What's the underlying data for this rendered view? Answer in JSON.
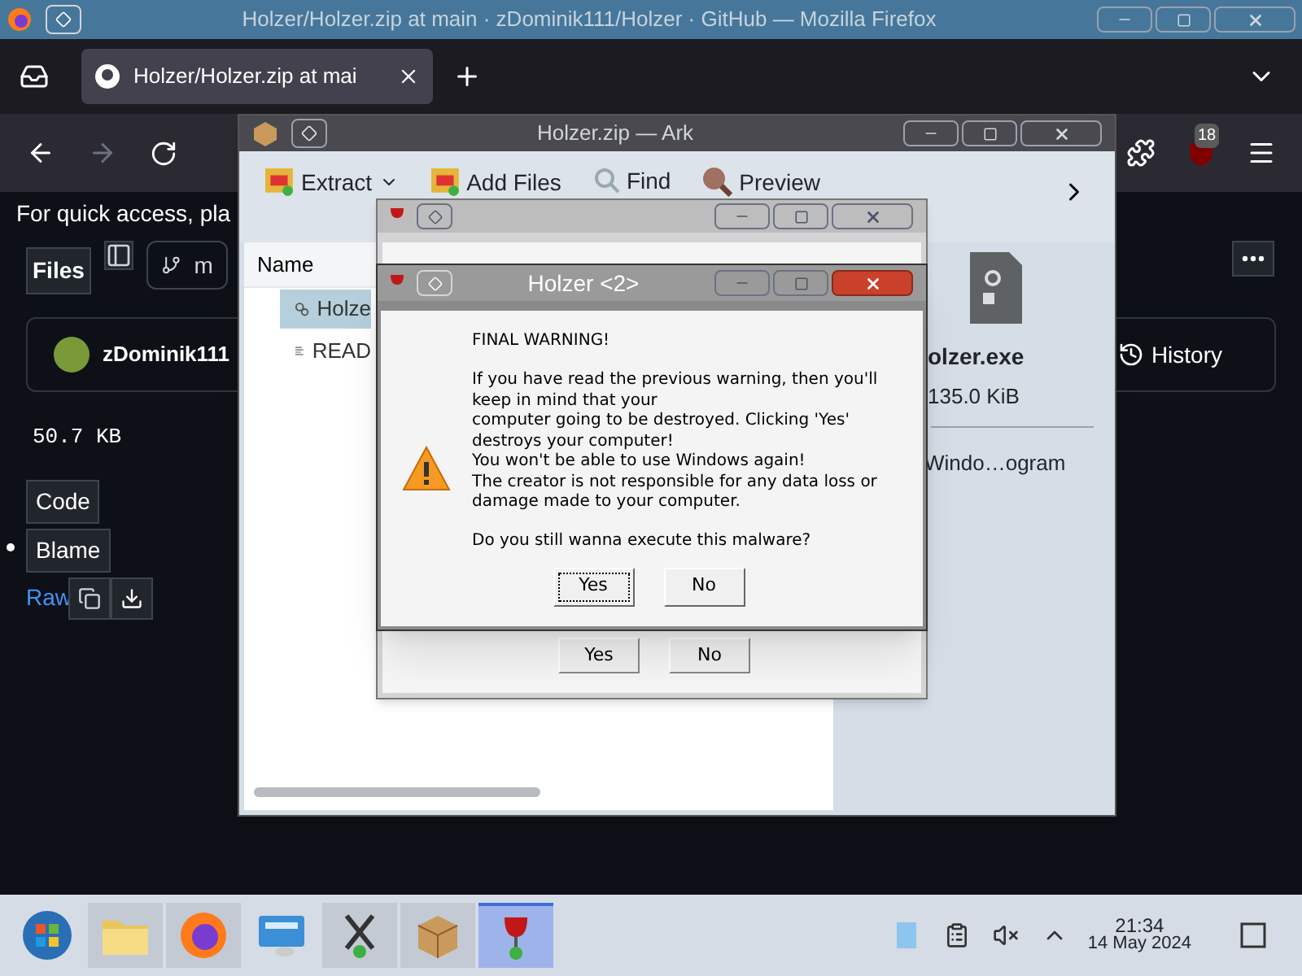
{
  "firefox": {
    "title": "Holzer/Holzer.zip at main · zDominik111/Holzer · GitHub — Mozilla Firefox",
    "tab": {
      "title": "Holzer/Holzer.zip at mai",
      "selected": true
    },
    "extension_badge": "18",
    "notice": "For quick access, pla",
    "github": {
      "files_button": "Files",
      "branch": "m",
      "author": "zDominik111",
      "history_button": "History",
      "size": "50.7 KB",
      "view_buttons": [
        "Code",
        "Blame"
      ],
      "raw_link": "Raw"
    }
  },
  "ark": {
    "title": "Holzer.zip — Ark",
    "toolbar": [
      {
        "label": "Extract",
        "kind": "extract",
        "dropdown": true
      },
      {
        "label": "Add Files",
        "kind": "add",
        "dropdown": false
      },
      {
        "label": "Find",
        "kind": "find",
        "dropdown": false
      },
      {
        "label": "Preview",
        "kind": "preview",
        "dropdown": false
      }
    ],
    "columns": [
      "Name"
    ],
    "rows": [
      {
        "name": "Holze",
        "kind": "program",
        "selected": true
      },
      {
        "name": "READ",
        "kind": "text",
        "selected": false
      }
    ],
    "details": {
      "name": "olzer.exe",
      "size": "135.0 KiB",
      "type": "Windo…ogram"
    }
  },
  "dialogs": [
    {
      "title": "Holzer <2>",
      "heading": "FINAL WARNING!",
      "message": "If you have read the previous warning, then you'll\nkeep in mind that your\ncomputer going to be destroyed. Clicking 'Yes'\ndestroys your computer!\nYou won't be able to use Windows again!\nThe creator is not responsible for any data loss or\ndamage made to your computer.",
      "question": "Do you still wanna execute this malware?",
      "buttons": [
        {
          "label": "Yes",
          "focused": true
        },
        {
          "label": "No",
          "focused": false
        }
      ]
    },
    {
      "buttons": [
        {
          "label": "Yes",
          "focused": false
        },
        {
          "label": "No",
          "focused": false
        }
      ]
    }
  ],
  "taskbar": {
    "apps": [
      {
        "kind": "start",
        "open": false,
        "selected": false
      },
      {
        "kind": "folder",
        "open": true,
        "selected": false
      },
      {
        "kind": "firefox",
        "open": true,
        "selected": false
      },
      {
        "kind": "remote",
        "open": false,
        "selected": false
      },
      {
        "kind": "tool",
        "open": true,
        "selected": false
      },
      {
        "kind": "archive",
        "open": true,
        "selected": false
      },
      {
        "kind": "wine",
        "open": true,
        "selected": true
      }
    ],
    "time": "21:34",
    "date": "14 May 2024"
  }
}
